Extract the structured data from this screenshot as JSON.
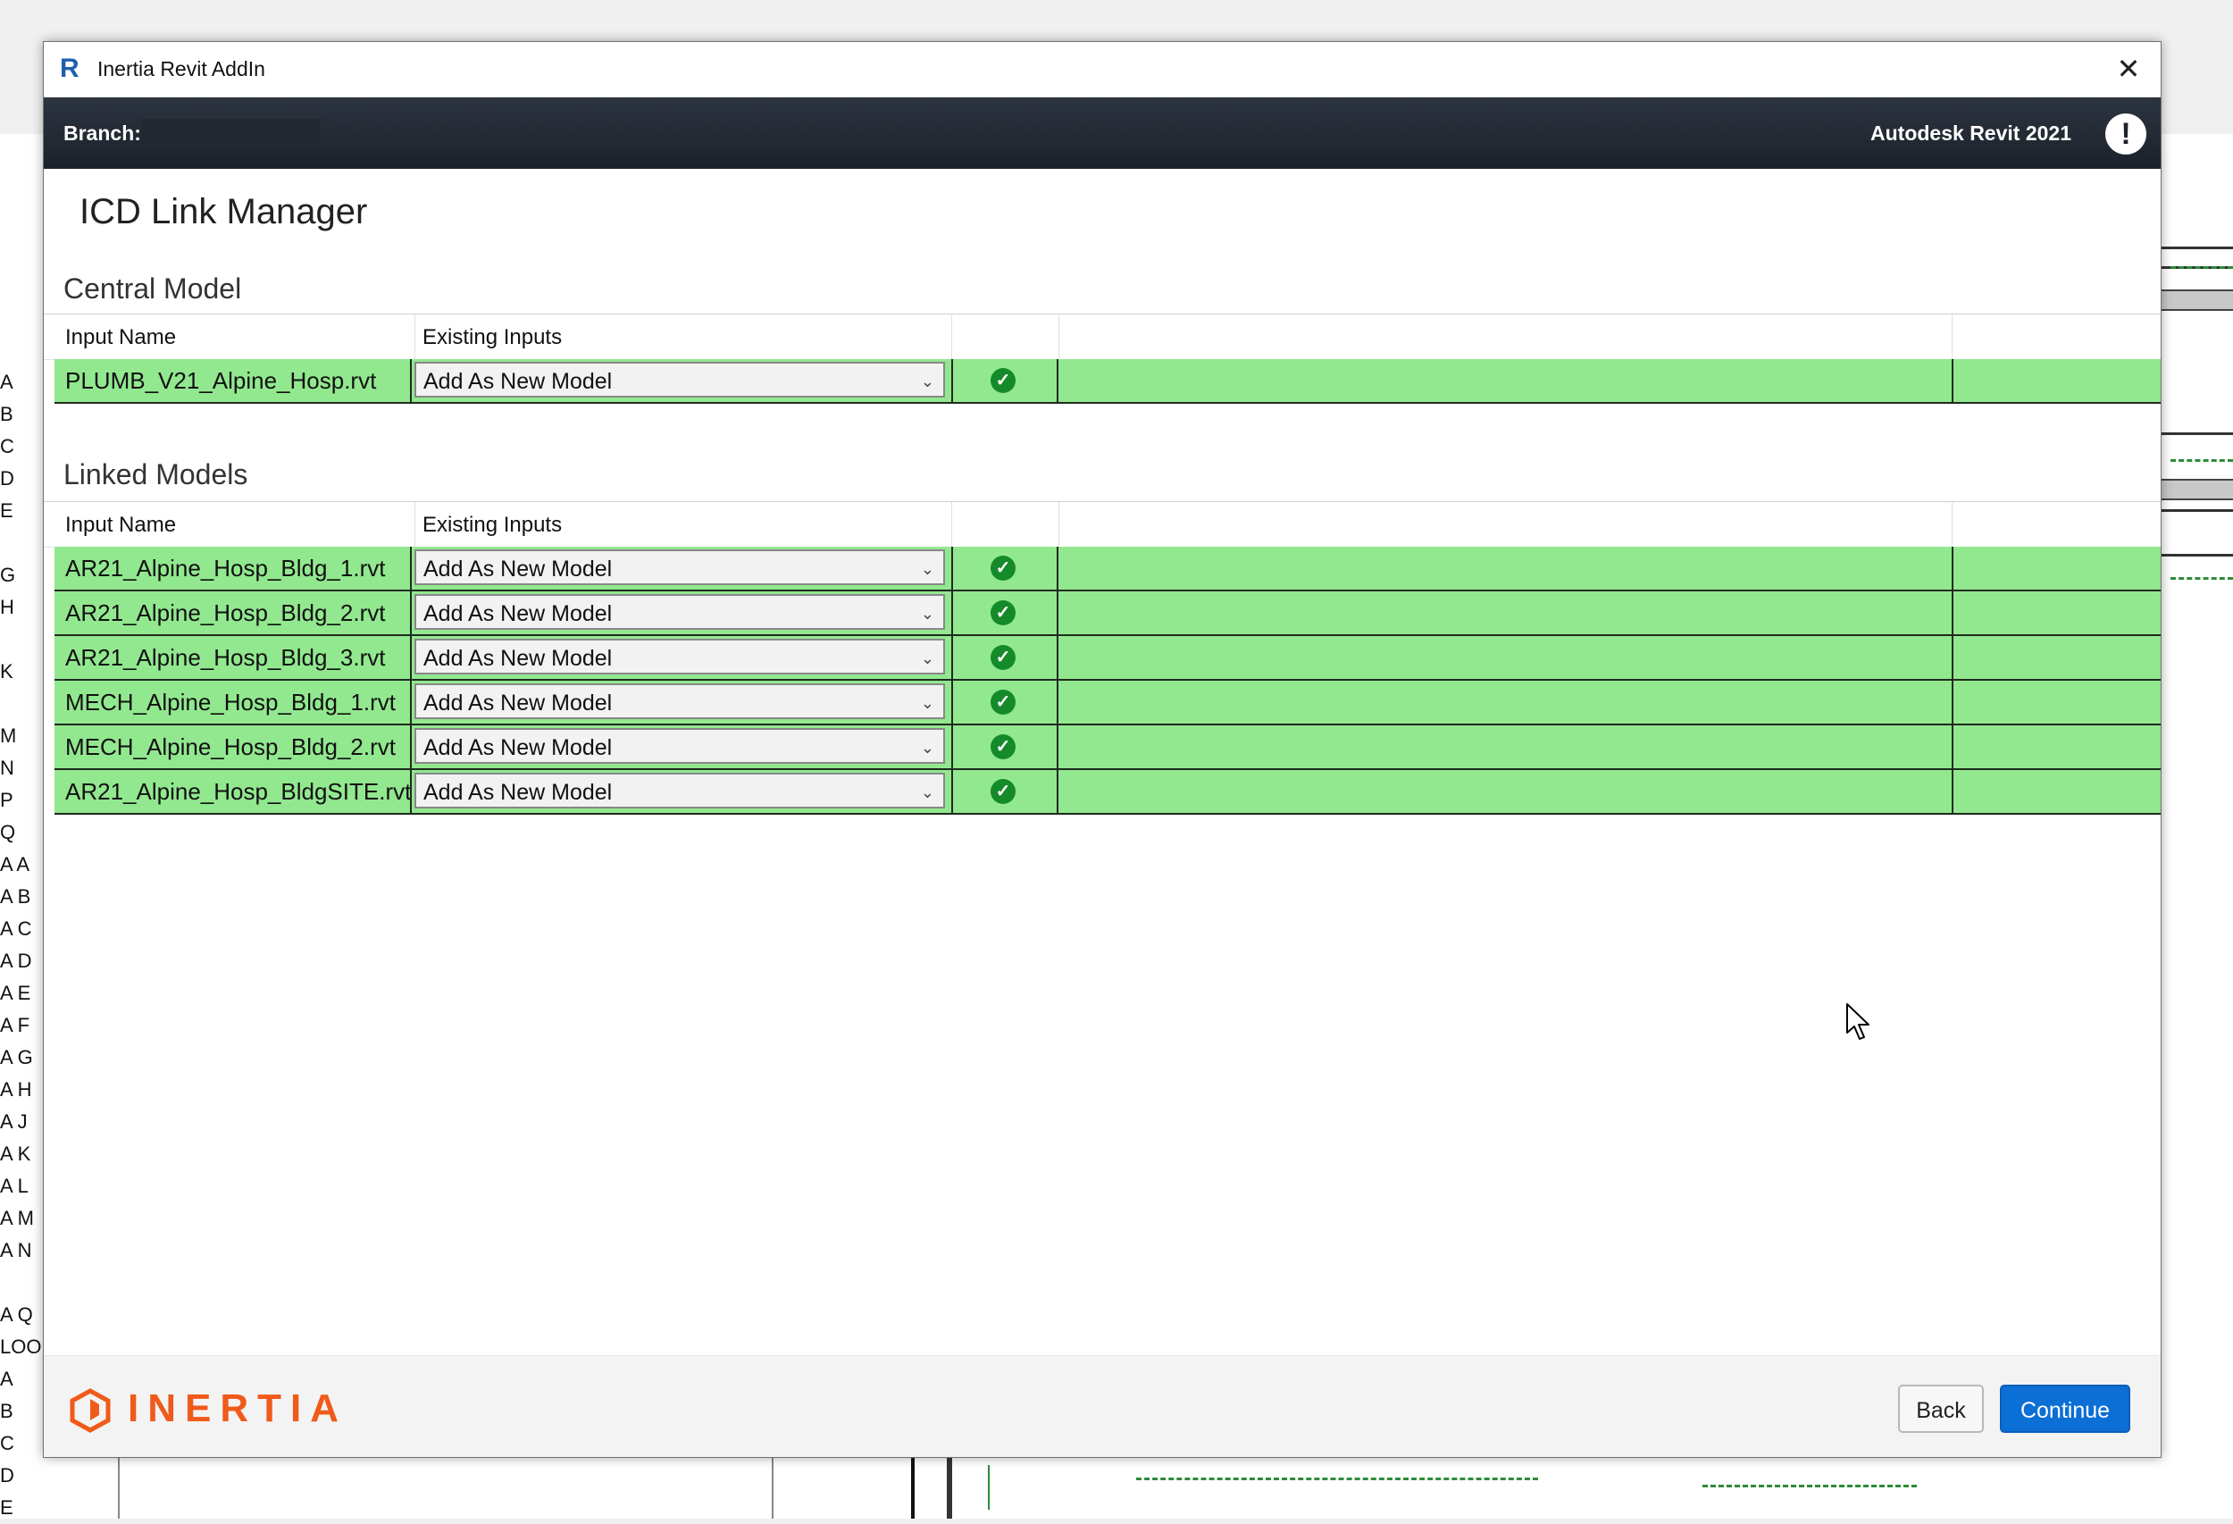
{
  "background": {
    "axis_labels": [
      "A",
      "B",
      "C",
      "D",
      "E",
      "",
      "G",
      "H",
      "",
      "K",
      "",
      "M",
      "N",
      "P",
      "Q",
      "A A",
      "A B",
      "A C",
      "A D",
      "A E",
      "A F",
      "A G",
      "A H",
      "A J",
      "A K",
      "A L",
      "A M",
      "A N",
      "",
      "A Q",
      "LOO",
      "A",
      "B",
      "C",
      "D",
      "E"
    ]
  },
  "window": {
    "title": "Inertia Revit AddIn",
    "close_glyph": "✕"
  },
  "header": {
    "branch_label": "Branch:",
    "branch_value": "",
    "version": "Autodesk Revit 2021",
    "alert_glyph": "!"
  },
  "page": {
    "title": "ICD Link Manager"
  },
  "central": {
    "title": "Central Model",
    "columns": [
      "Input Name",
      "Existing Inputs"
    ],
    "rows": [
      {
        "name": "PLUMB_V21_Alpine_Hosp.rvt",
        "input": "Add As New Model"
      }
    ]
  },
  "linked": {
    "title": "Linked Models",
    "columns": [
      "Input Name",
      "Existing Inputs"
    ],
    "rows": [
      {
        "name": "AR21_Alpine_Hosp_Bldg_1.rvt",
        "input": "Add As New Model"
      },
      {
        "name": "AR21_Alpine_Hosp_Bldg_2.rvt",
        "input": "Add As New Model"
      },
      {
        "name": "AR21_Alpine_Hosp_Bldg_3.rvt",
        "input": "Add As New Model"
      },
      {
        "name": "MECH_Alpine_Hosp_Bldg_1.rvt",
        "input": "Add As New Model"
      },
      {
        "name": "MECH_Alpine_Hosp_Bldg_2.rvt",
        "input": "Add As New Model"
      },
      {
        "name": "AR21_Alpine_Hosp_BldgSITE.rvt",
        "input": "Add As New Model"
      }
    ]
  },
  "footer": {
    "brand": "INERTIA",
    "back_label": "Back",
    "continue_label": "Continue"
  },
  "colors": {
    "row_ok": "#92e88f",
    "check": "#158a2a",
    "accent": "#0b6fd6",
    "brand": "#f05a1a"
  }
}
